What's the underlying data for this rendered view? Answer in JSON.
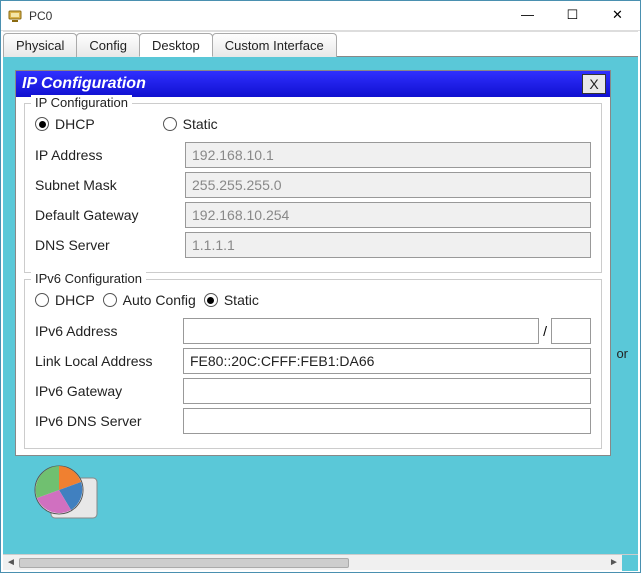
{
  "window": {
    "title": "PC0",
    "min": "—",
    "max": "☐",
    "close": "✕"
  },
  "tabs": {
    "physical": "Physical",
    "config": "Config",
    "desktop": "Desktop",
    "custom": "Custom Interface"
  },
  "ipcfg": {
    "title": "IP Configuration",
    "close": "X",
    "section": "IP Configuration",
    "dhcp": "DHCP",
    "static": "Static",
    "mode_selected": "dhcp",
    "ip_label": "IP Address",
    "ip_value": "192.168.10.1",
    "mask_label": "Subnet Mask",
    "mask_value": "255.255.255.0",
    "gw_label": "Default Gateway",
    "gw_value": "192.168.10.254",
    "dns_label": "DNS Server",
    "dns_value": "1.1.1.1"
  },
  "ip6": {
    "section": "IPv6 Configuration",
    "dhcp": "DHCP",
    "auto": "Auto Config",
    "static": "Static",
    "mode_selected": "static",
    "addr_label": "IPv6 Address",
    "addr_value": "",
    "prefix_sep": "/",
    "prefix_value": "",
    "ll_label": "Link Local Address",
    "ll_value": "FE80::20C:CFFF:FEB1:DA66",
    "gw_label": "IPv6 Gateway",
    "gw_value": "",
    "dns_label": "IPv6 DNS Server",
    "dns_value": ""
  },
  "fragments": {
    "or": "or"
  }
}
